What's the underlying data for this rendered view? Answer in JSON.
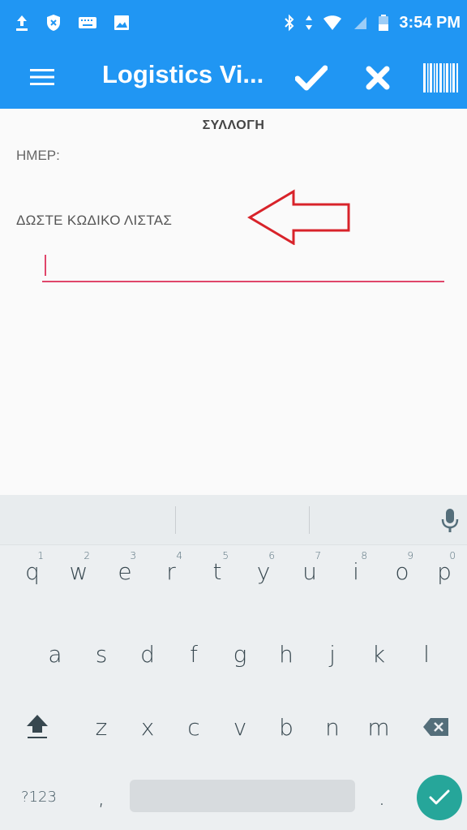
{
  "status_bar": {
    "time": "3:54 PM",
    "left_icons": [
      "upload-icon",
      "shield-icon",
      "keyboard-icon",
      "image-icon"
    ],
    "right_icons": [
      "bluetooth-icon",
      "data-arrows-icon",
      "wifi-icon",
      "no-sim-icon",
      "battery-icon"
    ]
  },
  "toolbar": {
    "title": "Logistics Vi...",
    "actions": [
      "menu-icon",
      "check-icon",
      "close-icon",
      "barcode-icon"
    ],
    "background": "#2096f3"
  },
  "form": {
    "section_title": "ΣΥΛΛΟΓΗ",
    "date_label": "ΗΜΕΡ:",
    "prompt_label": "ΔΩΣΤΕ ΚΩΔΙΚΟ ΛΙΣΤΑΣ",
    "input_value": "",
    "accent": "#e0466a"
  },
  "keyboard": {
    "row1": [
      {
        "key": "q",
        "hint": "1"
      },
      {
        "key": "w",
        "hint": "2"
      },
      {
        "key": "e",
        "hint": "3"
      },
      {
        "key": "r",
        "hint": "4"
      },
      {
        "key": "t",
        "hint": "5"
      },
      {
        "key": "y",
        "hint": "6"
      },
      {
        "key": "u",
        "hint": "7"
      },
      {
        "key": "i",
        "hint": "8"
      },
      {
        "key": "o",
        "hint": "9"
      },
      {
        "key": "p",
        "hint": "0"
      }
    ],
    "row2": [
      "a",
      "s",
      "d",
      "f",
      "g",
      "h",
      "j",
      "k",
      "l"
    ],
    "row3": [
      "z",
      "x",
      "c",
      "v",
      "b",
      "n",
      "m"
    ],
    "symbols_label": "?123",
    "comma": ",",
    "period": ".",
    "enter_color": "#26a69a"
  }
}
